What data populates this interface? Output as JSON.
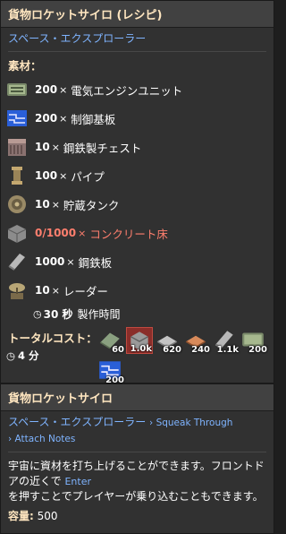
{
  "recipe": {
    "title": "貨物ロケットサイロ (レシピ)",
    "mod": "スペース・エクスプローラー",
    "ingredients_label": "素材：",
    "ingredients": [
      {
        "amount": "200",
        "name": "電気エンジンユニット",
        "icon": "electric-engine-icon",
        "missing": false
      },
      {
        "amount": "200",
        "name": "制御基板",
        "icon": "circuit-board-icon",
        "missing": false
      },
      {
        "amount": "10",
        "name": "鋼鉄製チェスト",
        "icon": "steel-chest-icon",
        "missing": false
      },
      {
        "amount": "100",
        "name": "パイプ",
        "icon": "pipe-icon",
        "missing": false
      },
      {
        "amount": "10",
        "name": "貯蔵タンク",
        "icon": "storage-tank-icon",
        "missing": false
      },
      {
        "amount": "0/1000",
        "name": "コンクリート床",
        "icon": "concrete-icon",
        "missing": true
      },
      {
        "amount": "1000",
        "name": "鋼鉄板",
        "icon": "steel-plate-icon",
        "missing": false
      },
      {
        "amount": "10",
        "name": "レーダー",
        "icon": "radar-icon",
        "missing": false
      }
    ],
    "times_sign": "×",
    "craft_time_value": "30 秒",
    "craft_time_label": "製作時間"
  },
  "total_cost": {
    "label": "トータルコスト：",
    "time": "4 分",
    "items": [
      {
        "count": "60",
        "icon": "steel-plate-green-icon",
        "missing": false
      },
      {
        "count": "1.0k",
        "icon": "concrete-icon",
        "missing": true
      },
      {
        "count": "620",
        "icon": "iron-plate-icon",
        "missing": false
      },
      {
        "count": "240",
        "icon": "copper-plate-icon",
        "missing": false
      },
      {
        "count": "1.1k",
        "icon": "steel-plate-icon",
        "missing": false
      },
      {
        "count": "200",
        "icon": "electric-engine-icon",
        "missing": false
      },
      {
        "count": "200",
        "icon": "circuit-board-icon",
        "missing": false
      }
    ]
  },
  "entity": {
    "title": "貨物ロケットサイロ",
    "mod": "スペース・エクスプローラー",
    "mod_extra1": "› Squeak Through",
    "mod_extra2": "› Attach Notes",
    "desc_part1": "宇宙に資材を打ち上げることができます。フロントドアの近くで",
    "key": "Enter",
    "desc_part2": "を押すことでプレイヤーが乗り込むこともできます。",
    "capacity_label": "容量:",
    "capacity_value": "500"
  },
  "colors": {
    "accent_text": "#ffe6c0",
    "mod_text": "#7fb4ff",
    "missing": "#ff7f6e"
  }
}
